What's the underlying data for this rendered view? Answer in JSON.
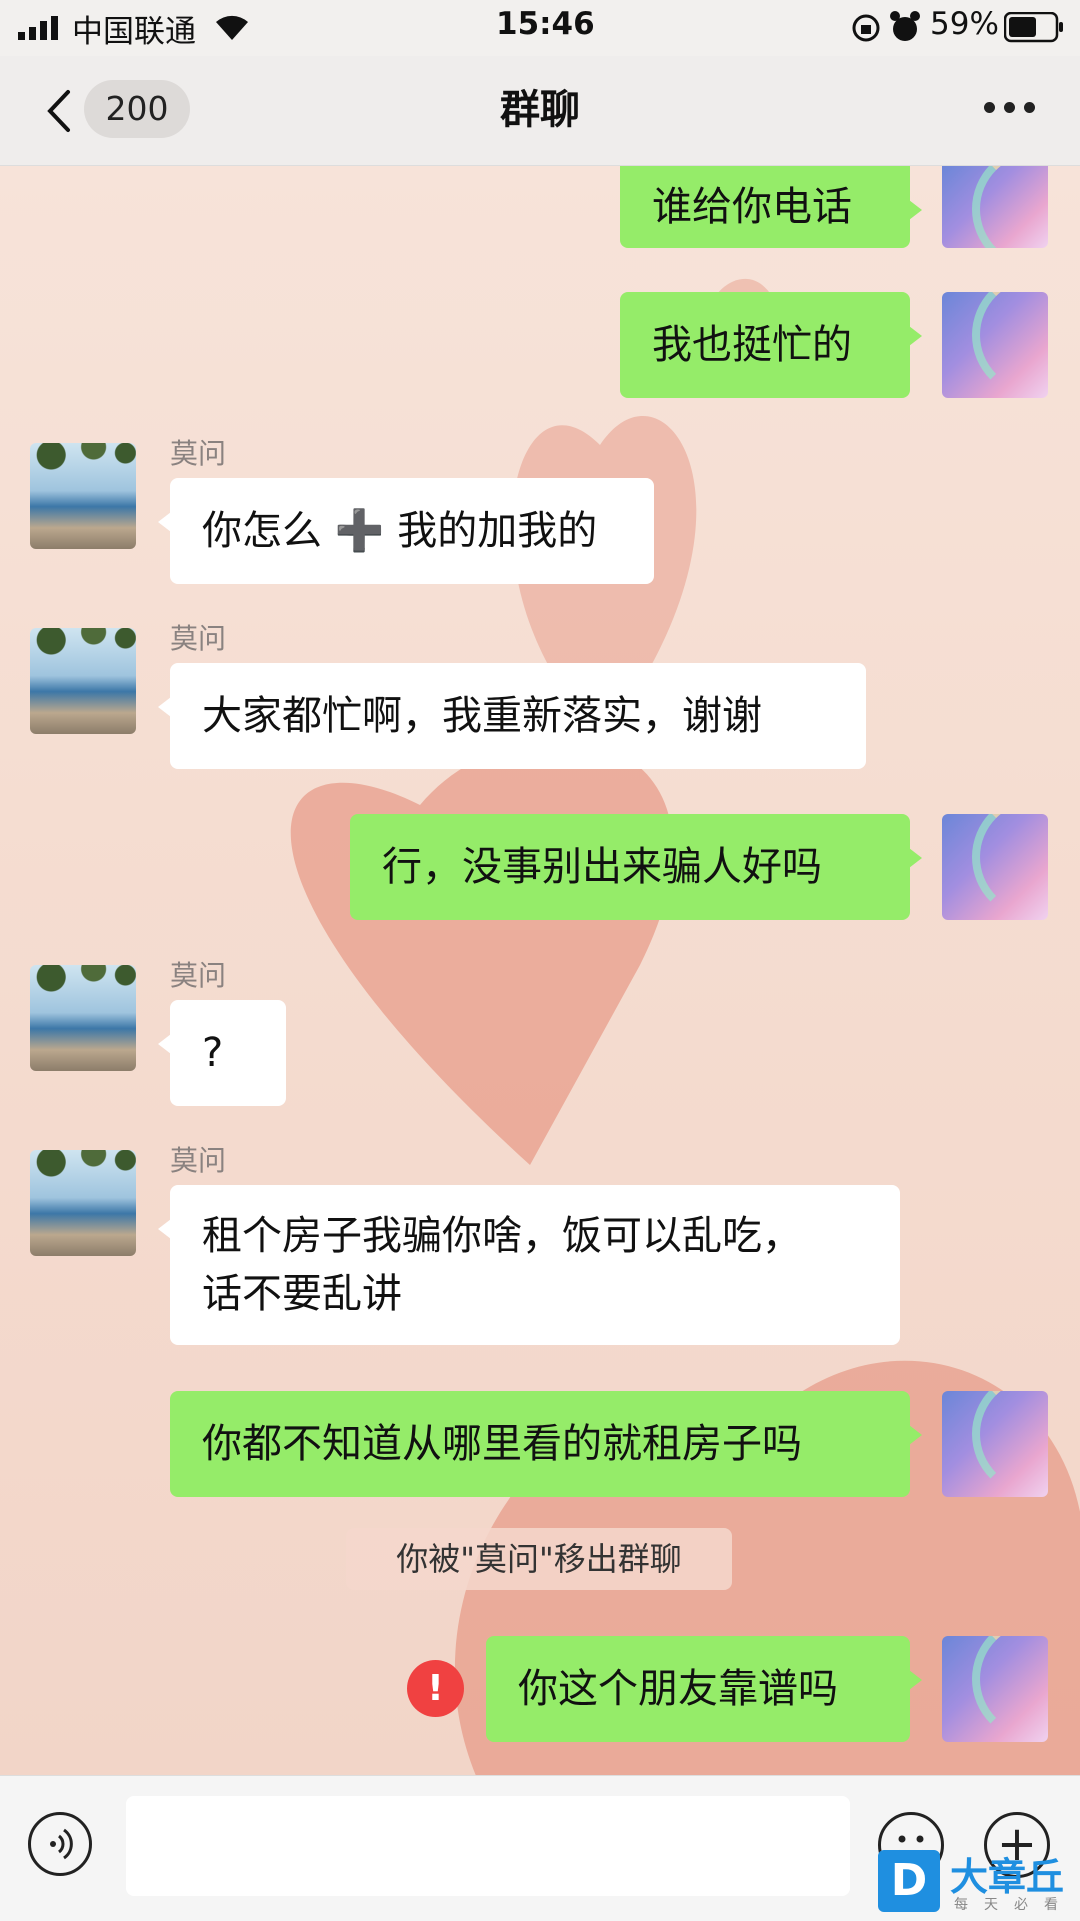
{
  "status_bar": {
    "carrier": "中国联通",
    "time": "15:46",
    "battery": "59%"
  },
  "header": {
    "back_count": "200",
    "title": "群聊"
  },
  "messages": [
    {
      "side": "me",
      "text": "谁给你电话"
    },
    {
      "side": "me",
      "text": "我也挺忙的"
    },
    {
      "side": "other",
      "sender": "莫问",
      "text": "你怎么 ➕ 我的加我的"
    },
    {
      "side": "other",
      "sender": "莫问",
      "text": "大家都忙啊，我重新落实，谢谢"
    },
    {
      "side": "me",
      "text": "行，没事别出来骗人好吗"
    },
    {
      "side": "other",
      "sender": "莫问",
      "text": "?"
    },
    {
      "side": "other",
      "sender": "莫问",
      "line1": "租个房子我骗你啥，饭可以乱吃，",
      "line2": "话不要乱讲"
    },
    {
      "side": "me",
      "text": "你都不知道从哪里看的就租房子吗"
    },
    {
      "side": "me",
      "text": "你这个朋友靠谱吗",
      "failed": true
    }
  ],
  "system_notice": "你被\"莫问\"移出群聊",
  "error_mark": "!",
  "watermark": {
    "logo": "D",
    "name": "大章丘",
    "slogan": "每天必看"
  }
}
